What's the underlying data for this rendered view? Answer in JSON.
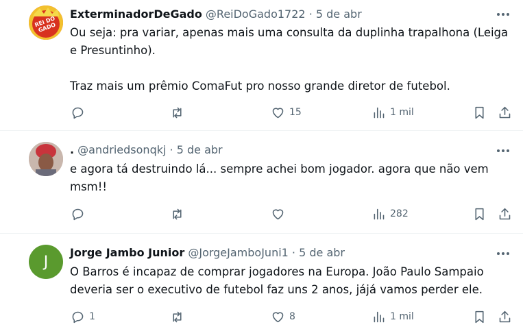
{
  "tweets": [
    {
      "name": "ExterminadorDeGado",
      "handle": "@ReiDoGado1722",
      "separator": "·",
      "date": "5 de abr",
      "avatar_text": "REI DO GADO",
      "text": "Ou seja: pra variar, apenas mais uma consulta da duplinha trapalhona (Leiga e Presuntinho).\n\nTraz mais um prêmio ComaFut pro nosso grande diretor de futebol.",
      "replies": "",
      "retweets": "",
      "likes": "15",
      "views": "1 mil"
    },
    {
      "name": ".",
      "handle": "@andriedsonqkj",
      "separator": "·",
      "date": "5 de abr",
      "avatar_text": "",
      "text": "e agora tá destruindo lá... sempre achei bom jogador. agora que não vem msm!!",
      "replies": "",
      "retweets": "",
      "likes": "",
      "views": "282"
    },
    {
      "name": "Jorge Jambo Junior",
      "handle": "@JorgeJamboJuni1",
      "separator": "·",
      "date": "5 de abr",
      "avatar_text": "J",
      "text": "O Barros é incapaz de comprar jogadores na Europa. João Paulo Sampaio deveria ser o executivo de futebol faz uns 2 anos, jájá vamos perder ele.",
      "replies": "1",
      "retweets": "",
      "likes": "8",
      "views": "1 mil"
    }
  ],
  "colors": {
    "text": "#0f1419",
    "secondary": "#536471",
    "divider": "#eff3f4",
    "avatar_green": "#5a9a2e"
  },
  "icons": [
    "more-icon",
    "reply-icon",
    "retweet-icon",
    "like-icon",
    "views-icon",
    "bookmark-icon",
    "share-icon"
  ]
}
